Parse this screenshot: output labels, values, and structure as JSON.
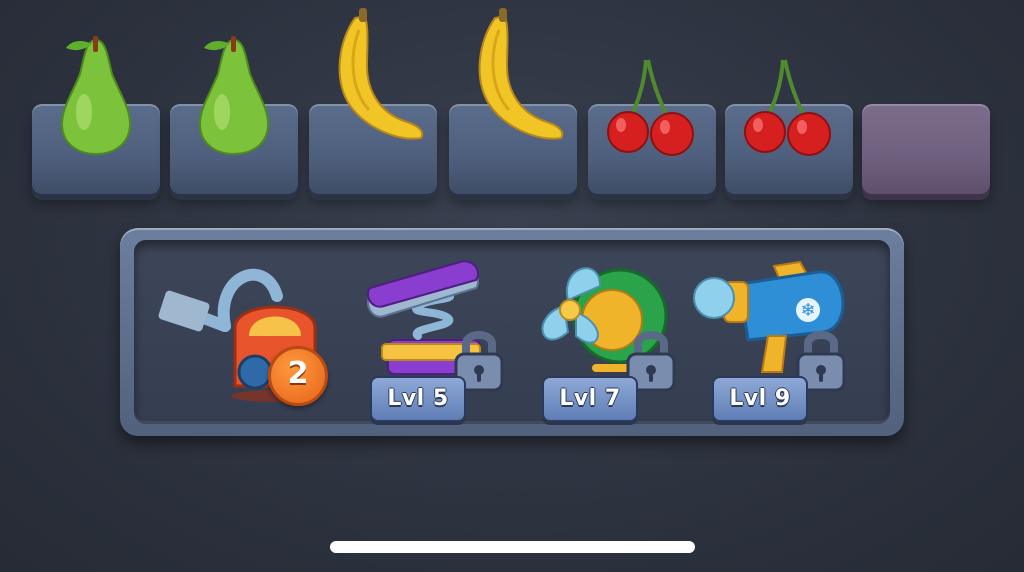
{
  "tray": {
    "slots": [
      {
        "item": "pear-icon"
      },
      {
        "item": "pear-icon"
      },
      {
        "item": "banana-icon"
      },
      {
        "item": "banana-icon"
      },
      {
        "item": "cherries-icon"
      },
      {
        "item": "cherries-icon"
      },
      {
        "item": "empty",
        "color": "#7d6d8c"
      }
    ]
  },
  "boosters": [
    {
      "name": "vacuum-icon",
      "count": "2",
      "locked": false
    },
    {
      "name": "spring-press-icon",
      "level_label": "Lvl 5",
      "locked": true
    },
    {
      "name": "fan-icon",
      "level_label": "Lvl 7",
      "locked": true
    },
    {
      "name": "freeze-cannon-icon",
      "level_label": "Lvl 9",
      "locked": true
    }
  ],
  "colors": {
    "background": "#2c323e",
    "slot": "#51617d",
    "empty_slot": "#7d6d8c",
    "badge_orange": "#e5621a",
    "level_badge": "#5f7eb5"
  }
}
